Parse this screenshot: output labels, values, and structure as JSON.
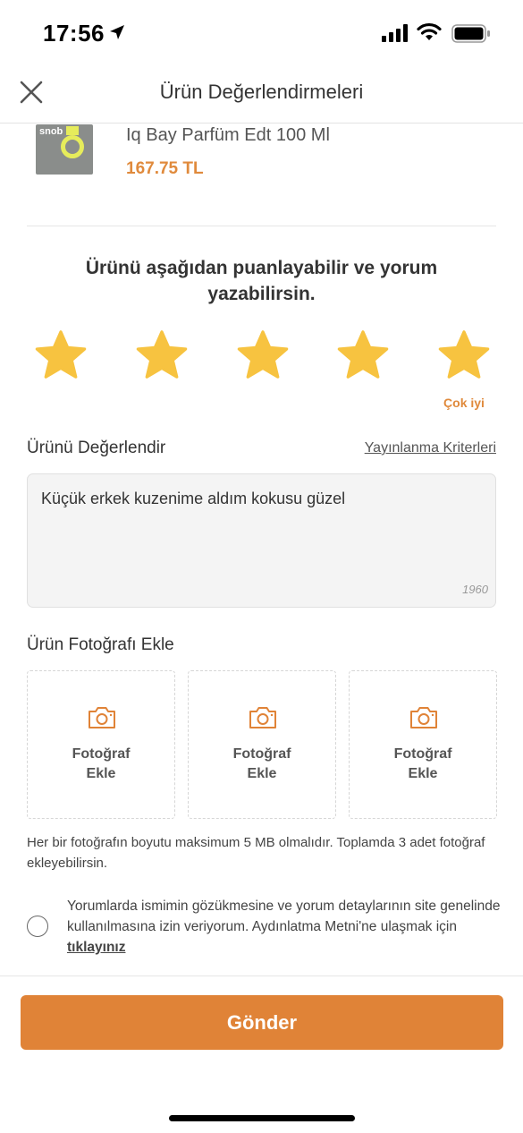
{
  "status_bar": {
    "time": "17:56",
    "icons": [
      "location-arrow-icon",
      "signal-icon",
      "wifi-icon",
      "battery-icon"
    ]
  },
  "header": {
    "title": "Ürün Değerlendirmeleri",
    "close_icon": "close-icon"
  },
  "product": {
    "name": "Iq Bay Parfüm Edt 100 Ml",
    "price": "167.75 TL",
    "image_brand": "snob"
  },
  "rating": {
    "prompt": "Ürünü aşağıdan puanlayabilir ve yorum yazabilirsin.",
    "stars_selected": 5,
    "stars_total": 5,
    "label": "Çok iyi"
  },
  "review": {
    "section_label": "Ürünü Değerlendir",
    "criteria_link": "Yayınlanma Kriterleri",
    "text": "Küçük erkek kuzenime aldım kokusu güzel",
    "char_remaining": "1960"
  },
  "photos": {
    "section_label": "Ürün Fotoğrafı Ekle",
    "slots": [
      {
        "line1": "Fotoğraf",
        "line2": "Ekle"
      },
      {
        "line1": "Fotoğraf",
        "line2": "Ekle"
      },
      {
        "line1": "Fotoğraf",
        "line2": "Ekle"
      }
    ],
    "note": "Her bir fotoğrafın boyutu maksimum 5 MB olmalıdır. Toplamda 3 adet fotoğraf ekleyebilirsin."
  },
  "consent": {
    "text": "Yorumlarda ismimin gözükmesine ve yorum detaylarının site genelinde kullanılmasına izin veriyorum. Aydınlatma Metni'ne ulaşmak için",
    "link": "tıklayınız",
    "checked": false
  },
  "submit_label": "Gönder",
  "colors": {
    "accent": "#e08337",
    "star": "#f7c340",
    "price": "#e08a3c"
  }
}
